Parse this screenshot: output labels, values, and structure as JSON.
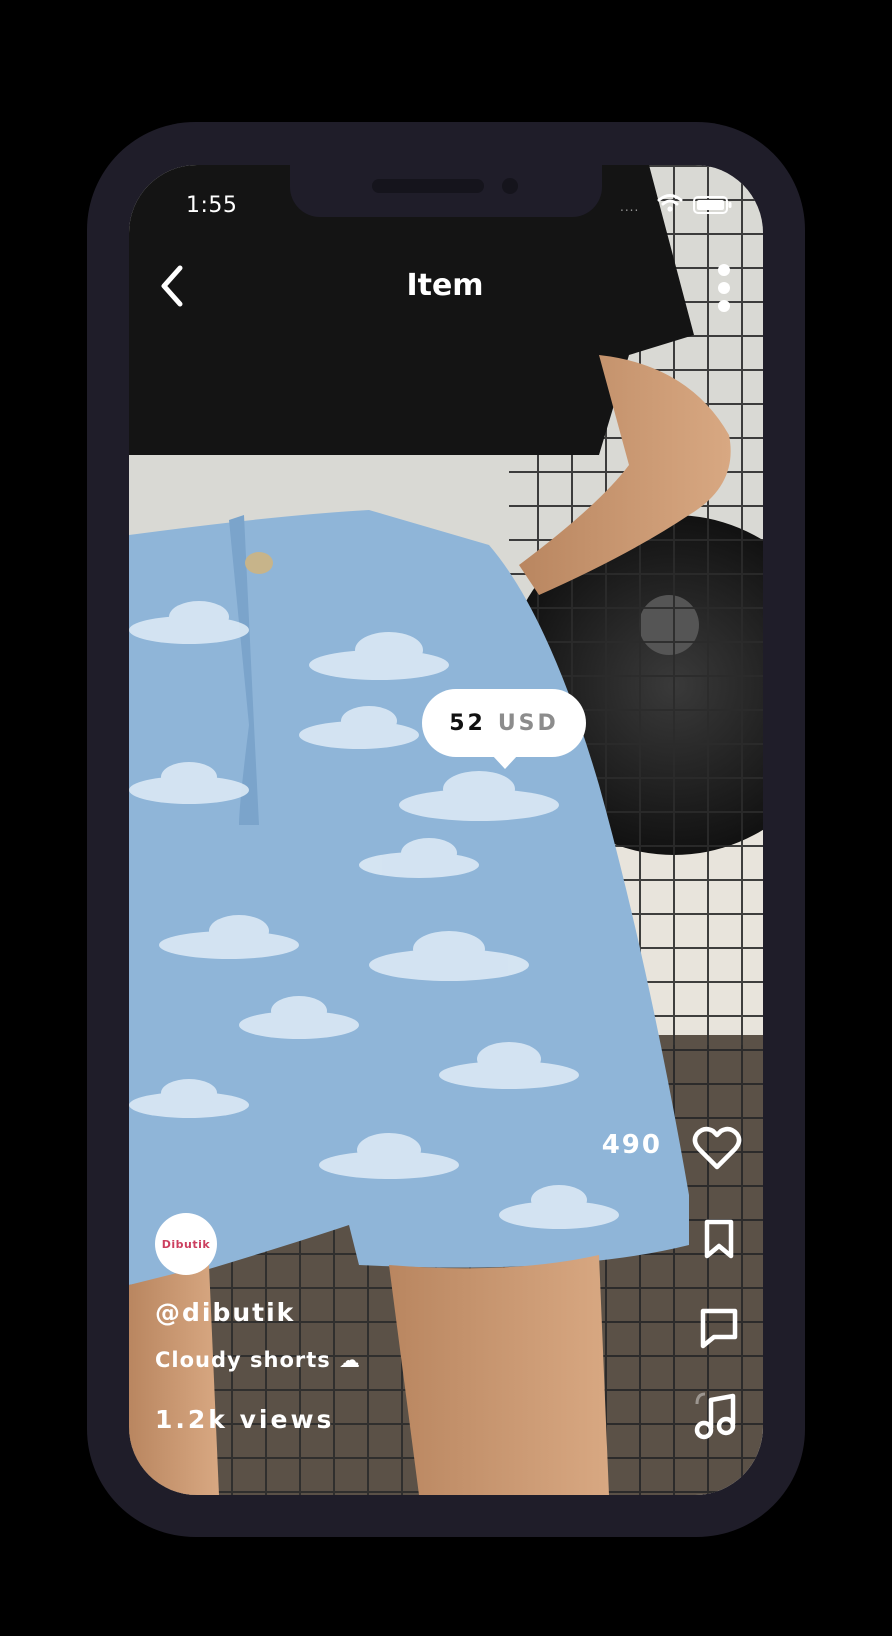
{
  "status_bar": {
    "time": "1:55",
    "signal": "....",
    "icons": [
      "wifi-icon",
      "battery-icon"
    ]
  },
  "header": {
    "title": "Item",
    "back_icon": "chevron-left-icon",
    "more_icon": "vertical-dots-icon"
  },
  "price": {
    "amount": "52",
    "currency": "USD"
  },
  "actions": {
    "like_count": "490",
    "icons": [
      "heart-icon",
      "bookmark-icon",
      "comment-icon",
      "music-note-icon"
    ]
  },
  "seller": {
    "avatar_text": "Dibutik",
    "username": "@dibutik"
  },
  "item": {
    "title": "Cloudy shorts ☁",
    "views": "1.2k views"
  },
  "colors": {
    "device_frame": "#1f1d29",
    "background": "#000000",
    "text": "#ffffff",
    "price_currency": "#8c8c8c"
  }
}
